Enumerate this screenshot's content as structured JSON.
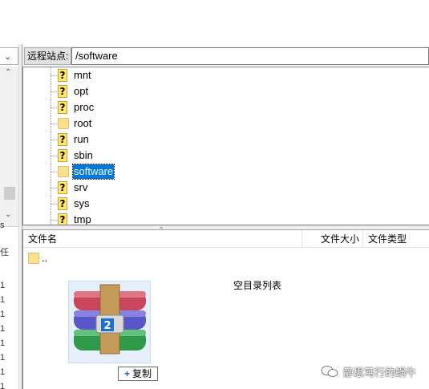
{
  "remote": {
    "site_label": "远程站点:",
    "path": "/software",
    "tree": [
      {
        "name": "mnt",
        "icon": "question-icon"
      },
      {
        "name": "opt",
        "icon": "question-icon"
      },
      {
        "name": "proc",
        "icon": "question-icon"
      },
      {
        "name": "root",
        "icon": "folder-icon"
      },
      {
        "name": "run",
        "icon": "question-icon"
      },
      {
        "name": "sbin",
        "icon": "question-icon"
      },
      {
        "name": "software",
        "icon": "folder-icon",
        "selected": true
      },
      {
        "name": "srv",
        "icon": "question-icon"
      },
      {
        "name": "sys",
        "icon": "question-icon"
      },
      {
        "name": "tmp",
        "icon": "question-icon"
      }
    ],
    "list": {
      "columns": [
        "文件名",
        "文件大小",
        "文件类型"
      ],
      "parent_entry": "..",
      "empty_message": "空目录列表"
    }
  },
  "local_fragment": {
    "tree_text": "s",
    "list_header_text": "任",
    "list_numbers": [
      "1",
      "1",
      "1",
      "1",
      "1",
      "1",
      "1",
      "1",
      "1"
    ]
  },
  "drag": {
    "badge": "2",
    "tooltip_label": "复制",
    "tooltip_symbol": "+"
  },
  "watermark": {
    "text": "静思笃行的蜗牛"
  },
  "colors": {
    "selection": "#0078d7",
    "question_fill": "#ffe77a",
    "folder_fill": "#fbe08f"
  }
}
